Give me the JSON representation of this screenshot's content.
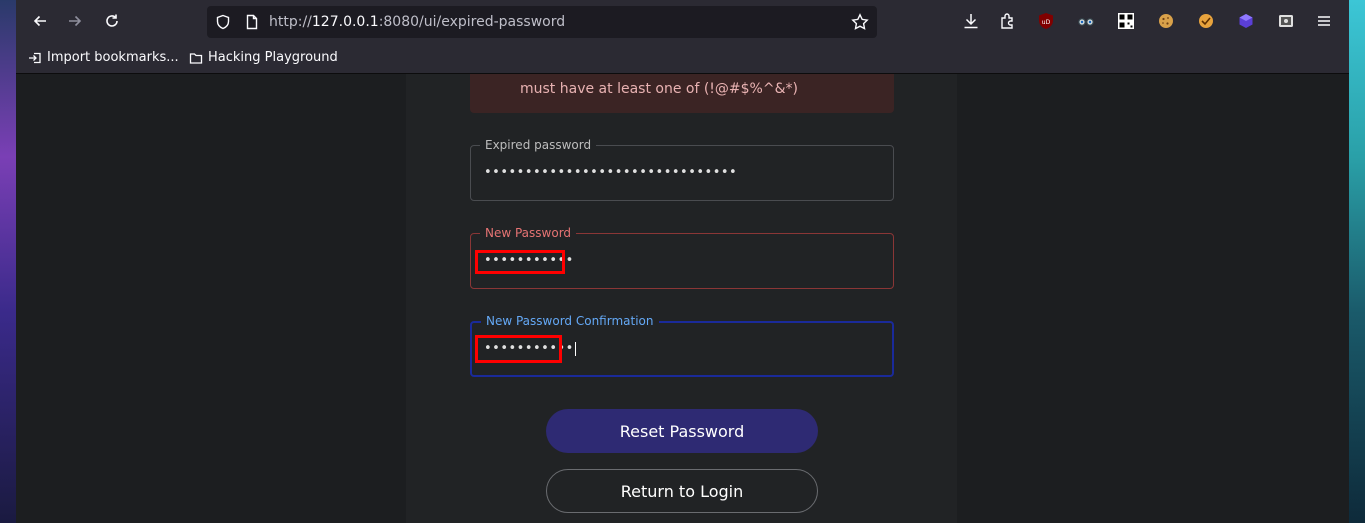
{
  "browser": {
    "url_scheme": "http://",
    "url_host": "127.0.0.1",
    "url_rest": ":8080/ui/expired-password"
  },
  "bookmarks": {
    "import_label": "Import bookmarks...",
    "folder_label": "Hacking Playground"
  },
  "alert": {
    "text": "must have at least one of (!@#$%^&*)"
  },
  "form": {
    "expired_password": {
      "label": "Expired password",
      "value": "•••••••••••••••••••••••••••••••"
    },
    "new_password": {
      "label": "New Password",
      "value": "•••••••••••"
    },
    "new_password_confirmation": {
      "label": "New Password Confirmation",
      "value": "•••••••••••"
    }
  },
  "buttons": {
    "reset": "Reset Password",
    "return_login": "Return to Login"
  },
  "colors": {
    "error": "#e57373",
    "focus": "#64a8f5",
    "primary_button": "#2e2a73",
    "highlight": "#ff0000"
  }
}
